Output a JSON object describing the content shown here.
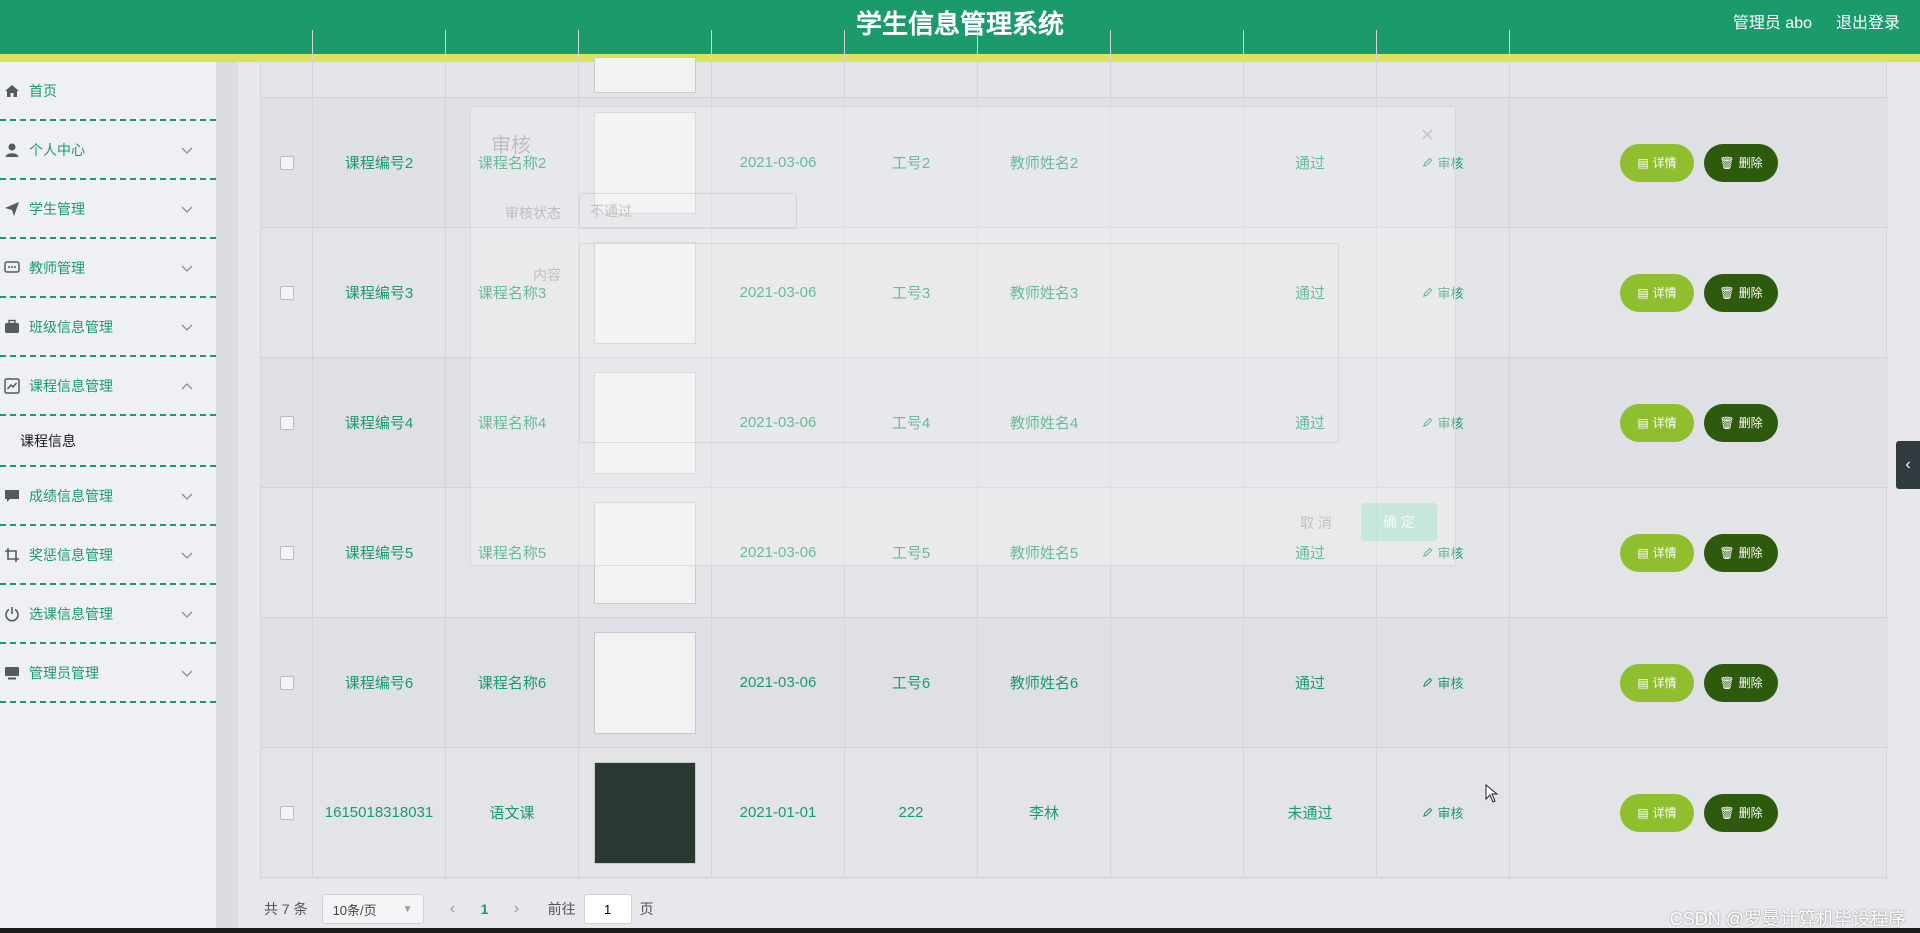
{
  "header": {
    "title": "学生信息管理系统",
    "user": "管理员 abo",
    "logout": "退出登录"
  },
  "sidebar": {
    "items": [
      {
        "label": "首页",
        "icon": "home-icon",
        "chevron": false
      },
      {
        "label": "个人中心",
        "icon": "user-icon",
        "chevron": "down"
      },
      {
        "label": "学生管理",
        "icon": "send-icon",
        "chevron": "down"
      },
      {
        "label": "教师管理",
        "icon": "chat-icon",
        "chevron": "down"
      },
      {
        "label": "班级信息管理",
        "icon": "briefcase-icon",
        "chevron": "down"
      },
      {
        "label": "课程信息管理",
        "icon": "chart-icon",
        "chevron": "up"
      },
      {
        "label": "成绩信息管理",
        "icon": "message-icon",
        "chevron": "down"
      },
      {
        "label": "奖惩信息管理",
        "icon": "crop-icon",
        "chevron": "down"
      },
      {
        "label": "选课信息管理",
        "icon": "power-icon",
        "chevron": "down"
      },
      {
        "label": "管理员管理",
        "icon": "monitor-icon",
        "chevron": "down"
      }
    ],
    "submenu": "课程信息"
  },
  "table": {
    "rows": [
      {
        "code": "课程编号2",
        "name": "课程名称2",
        "date": "2021-03-06",
        "tno": "工号2",
        "teacher": "教师姓名2",
        "status": "通过",
        "audit": "审核",
        "detail": "详情",
        "delete": "删除"
      },
      {
        "code": "课程编号3",
        "name": "课程名称3",
        "date": "2021-03-06",
        "tno": "工号3",
        "teacher": "教师姓名3",
        "status": "通过",
        "audit": "审核",
        "detail": "详情",
        "delete": "删除"
      },
      {
        "code": "课程编号4",
        "name": "课程名称4",
        "date": "2021-03-06",
        "tno": "工号4",
        "teacher": "教师姓名4",
        "status": "通过",
        "audit": "审核",
        "detail": "详情",
        "delete": "删除"
      },
      {
        "code": "课程编号5",
        "name": "课程名称5",
        "date": "2021-03-06",
        "tno": "工号5",
        "teacher": "教师姓名5",
        "status": "通过",
        "audit": "审核",
        "detail": "详情",
        "delete": "删除"
      },
      {
        "code": "课程编号6",
        "name": "课程名称6",
        "date": "2021-03-06",
        "tno": "工号6",
        "teacher": "教师姓名6",
        "status": "通过",
        "audit": "审核",
        "detail": "详情",
        "delete": "删除"
      },
      {
        "code": "1615018318031",
        "name": "语文课",
        "date": "2021-01-01",
        "tno": "222",
        "teacher": "李林",
        "status": "未通过",
        "audit": "审核",
        "detail": "详情",
        "delete": "删除"
      }
    ]
  },
  "pager": {
    "total": "共 7 条",
    "page_size": "10条/页",
    "current": "1",
    "goto_label": "前往",
    "goto_value": "1",
    "page_suffix": "页"
  },
  "dialog": {
    "title": "审核",
    "status_label": "审核状态",
    "status_value": "不通过",
    "content_label": "内容",
    "cancel": "取 消",
    "ok": "确 定"
  },
  "watermark": "CSDN @罗曼计算机毕设程序",
  "colors": {
    "primary": "#1b9a6c",
    "accent": "#d8e35a",
    "detail_btn": "#8fbf2e",
    "delete_btn": "#2e5a0e"
  }
}
